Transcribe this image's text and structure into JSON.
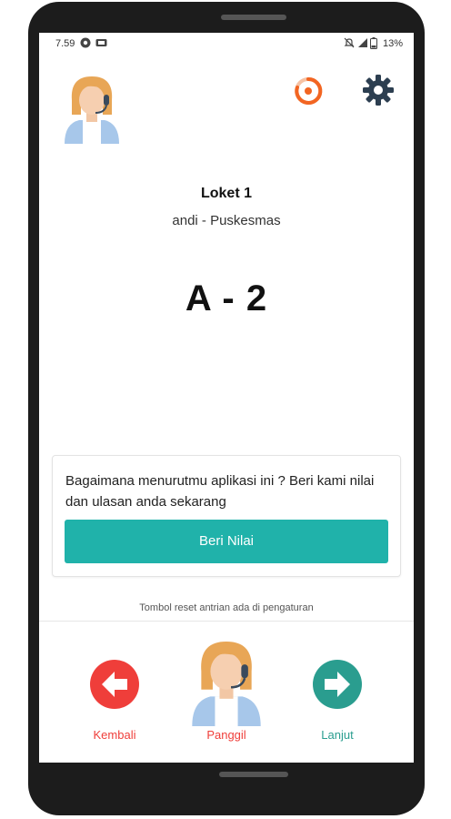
{
  "status_bar": {
    "time": "7.59",
    "battery": "13%"
  },
  "header": {
    "avatar_icon": "operator-avatar-icon",
    "timer_icon": "timer-ring-icon",
    "settings_icon": "gear-icon"
  },
  "counter": {
    "name": "Loket 1",
    "operator": "andi - Puskesmas",
    "queue_number": "A - 2"
  },
  "feedback": {
    "text": "Bagaimana menurutmu aplikasi ini ? Beri kami nilai dan ulasan anda sekarang",
    "button_label": "Beri Nilai"
  },
  "hint": "Tombol reset antrian ada di pengaturan",
  "bottom_nav": {
    "back_label": "Kembali",
    "call_label": "Panggil",
    "next_label": "Lanjut"
  },
  "colors": {
    "accent": "#20b2aa",
    "back": "#ef3e3a",
    "next": "#2a9d8f",
    "timer": "#f26522",
    "settings": "#2c3e50"
  }
}
